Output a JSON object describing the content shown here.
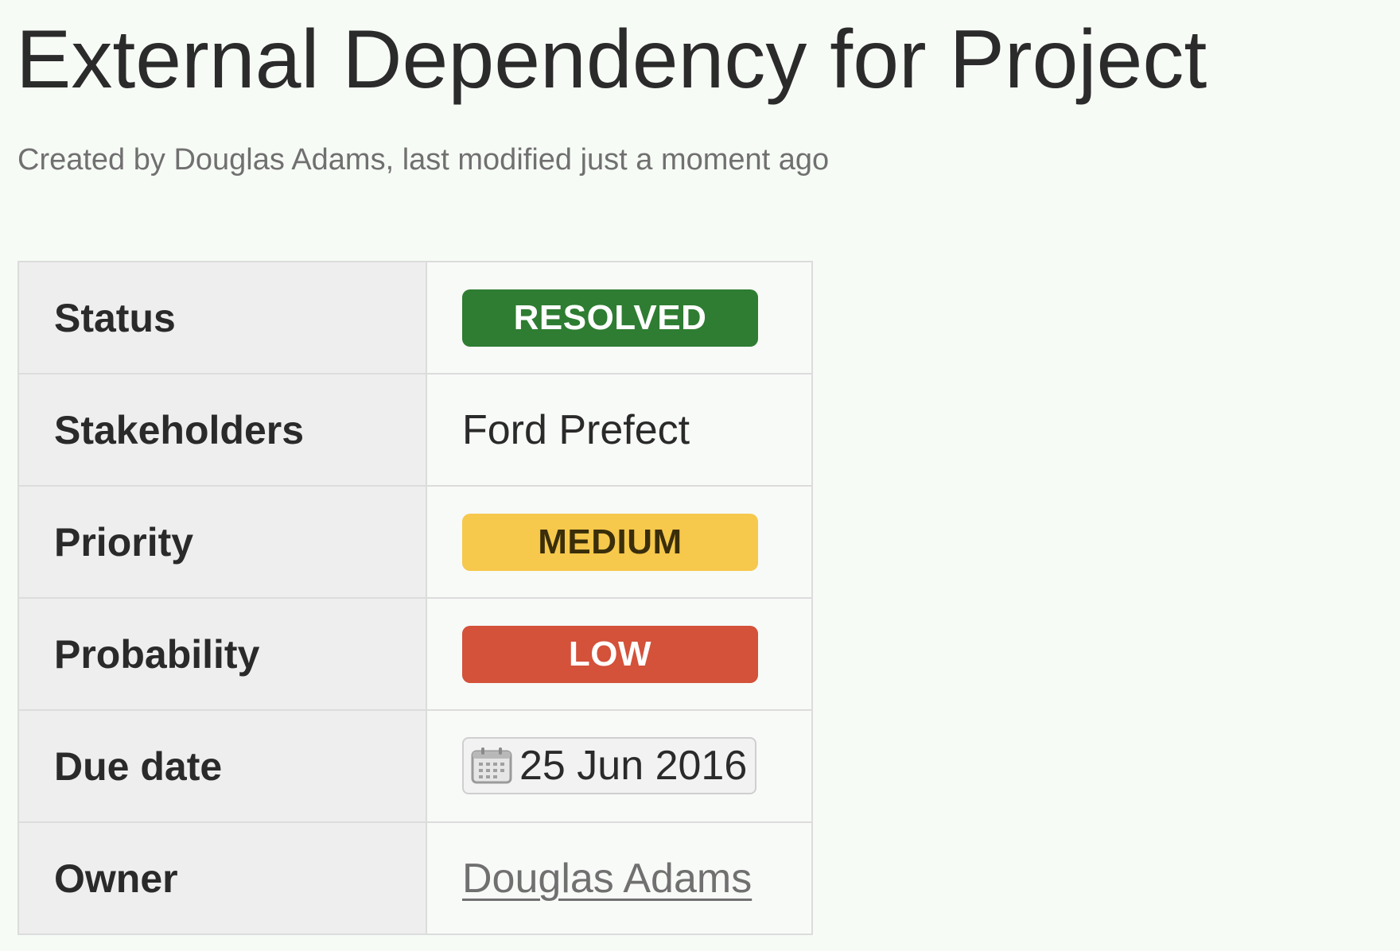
{
  "page": {
    "title": "External Dependency for Project",
    "byline": "Created by Douglas Adams, last modified just a moment ago"
  },
  "properties": [
    {
      "key": "Status",
      "value": "RESOLVED",
      "kind": "lozenge",
      "color": "#2e7d32"
    },
    {
      "key": "Stakeholders",
      "value": "Ford Prefect",
      "kind": "text"
    },
    {
      "key": "Priority",
      "value": "MEDIUM",
      "kind": "lozenge",
      "color": "#f6c84c"
    },
    {
      "key": "Probability",
      "value": "LOW",
      "kind": "lozenge",
      "color": "#d4513a"
    },
    {
      "key": "Due date",
      "value": "25 Jun 2016",
      "kind": "date",
      "icon": "calendar-icon"
    },
    {
      "key": "Owner",
      "value": "Douglas Adams",
      "kind": "user-link"
    }
  ]
}
